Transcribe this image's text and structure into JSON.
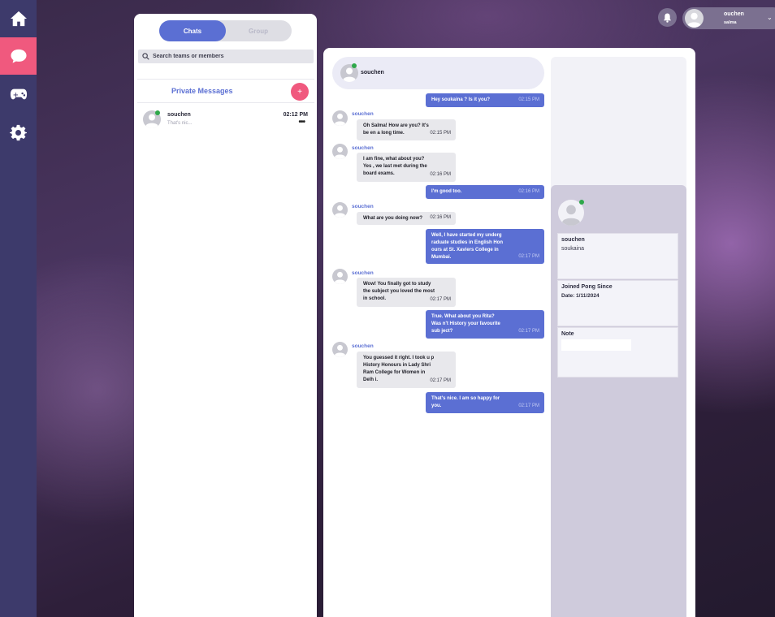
{
  "nav": {
    "items": [
      {
        "icon": "home-icon"
      },
      {
        "icon": "chat-icon",
        "active": true
      },
      {
        "icon": "gamepad-icon"
      },
      {
        "icon": "gear-icon"
      }
    ],
    "active_color": "#f0597e"
  },
  "header": {
    "user_name": "ouchen",
    "user_sub": "salma"
  },
  "sidebar": {
    "tabs": [
      "Chats",
      "Group"
    ],
    "active_tab": "Chats",
    "search_placeholder": "Search teams or members",
    "section_title": "Private Messages",
    "add_label": "+",
    "conversations": [
      {
        "name": "souchen",
        "preview": "That's nic...",
        "time": "02:12 PM",
        "more": "•••",
        "online": true
      }
    ]
  },
  "chat": {
    "contact_name": "souchen",
    "messages": [
      {
        "dir": "out",
        "text": "Hey soukaina ? Is it you?",
        "time": "02:15 PM"
      },
      {
        "dir": "in",
        "sender": "souchen",
        "text": "Oh Salma! How are you? It's be en a long time.",
        "time": "02:15 PM"
      },
      {
        "dir": "in",
        "sender": "souchen",
        "text": "I am fine, what about you? Yes , we last met during the board exams.",
        "time": "02:16 PM"
      },
      {
        "dir": "out",
        "text": "I'm good too.",
        "time": "02:16 PM"
      },
      {
        "dir": "in",
        "sender": "souchen",
        "text": "What are you doing now?",
        "time": "02:16 PM"
      },
      {
        "dir": "out",
        "text": "Well, I have started my underg raduate studies in English Hon ours at St. Xaviers College in Mumbai.",
        "time": "02:17 PM"
      },
      {
        "dir": "in",
        "sender": "souchen",
        "text": "Wow! You finally got to study the subject you loved the most in school.",
        "time": "02:17 PM"
      },
      {
        "dir": "out",
        "text": "True. What about you Rita? Was n't History your favourite sub ject?",
        "time": "02:17 PM"
      },
      {
        "dir": "in",
        "sender": "souchen",
        "text": "You guessed it right. I took u p History Honours in Lady Shri Ram College for Women in Delh i.",
        "time": "02:17 PM"
      },
      {
        "dir": "out",
        "text": "That's nice. I am so happy for you.",
        "time": "02:17 PM"
      }
    ]
  },
  "profile": {
    "name": "souchen",
    "login": "soukaina",
    "joined_label": "Joined Pong Since",
    "joined_date": "Date: 1/11/2024",
    "note_label": "Note"
  },
  "colors": {
    "accent": "#5b6fd3",
    "pink": "#f0597e",
    "online": "#2ea84a"
  }
}
